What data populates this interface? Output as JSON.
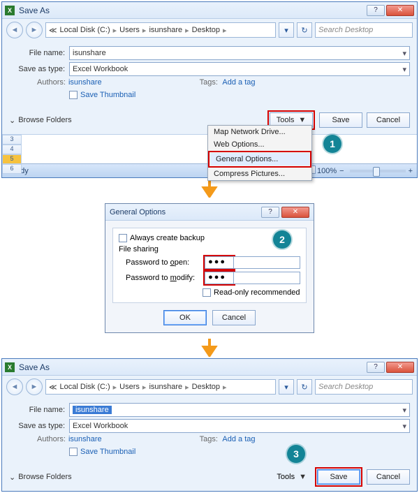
{
  "saveas1": {
    "title": "Save As",
    "breadcrumb": [
      "Local Disk (C:)",
      "Users",
      "isunshare",
      "Desktop"
    ],
    "search_placeholder": "Search Desktop",
    "file_name_label": "File name:",
    "file_name_value": "isunshare",
    "save_as_type_label": "Save as type:",
    "save_as_type_value": "Excel Workbook",
    "authors_label": "Authors:",
    "authors_value": "isunshare",
    "tags_label": "Tags:",
    "tags_value": "Add a tag",
    "save_thumbnail": "Save Thumbnail",
    "browse_folders": "Browse Folders",
    "tools_label": "Tools",
    "save_label": "Save",
    "cancel_label": "Cancel",
    "tools_menu": [
      "Map Network Drive...",
      "Web Options...",
      "General Options...",
      "Compress Pictures..."
    ]
  },
  "statusbar": {
    "ready": "Ready",
    "zoom": "100%"
  },
  "rows": [
    "3",
    "4",
    "5",
    "6"
  ],
  "general_options": {
    "title": "General Options",
    "always_backup": "Always create backup",
    "file_sharing": "File sharing",
    "pw_open_label_pre": "Password to ",
    "pw_open_u": "o",
    "pw_open_post": "pen:",
    "pw_modify_label_pre": "Password to ",
    "pw_modify_u": "m",
    "pw_modify_post": "odify:",
    "pw_open_value": "●●●",
    "pw_modify_value": "●●●",
    "readonly_pre": "",
    "readonly_u": "R",
    "readonly_post": "ead-only recommended",
    "ok": "OK",
    "cancel": "Cancel"
  },
  "saveas2": {
    "file_name_value": "isunshare"
  },
  "callouts": {
    "c1": "1",
    "c2": "2",
    "c3": "3"
  }
}
